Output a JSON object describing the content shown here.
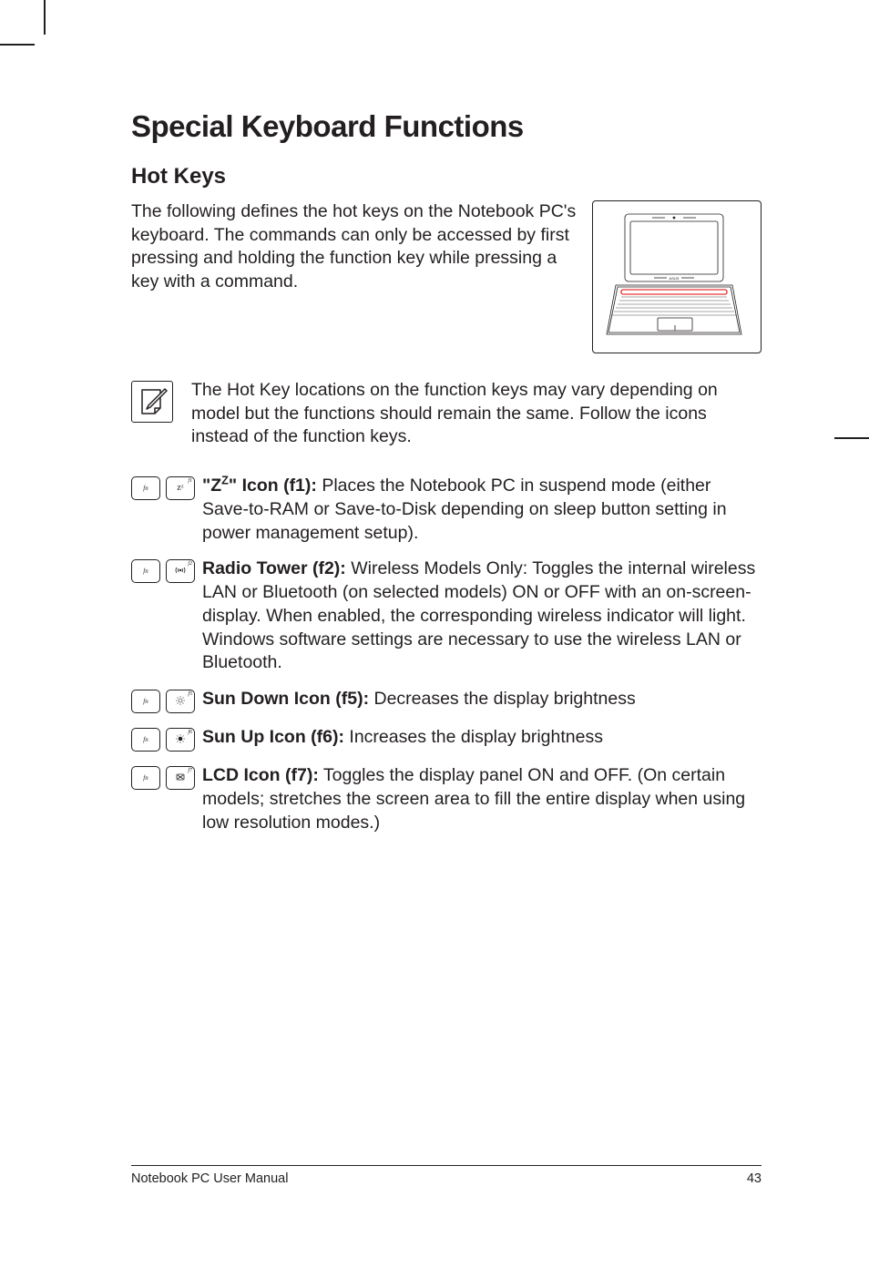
{
  "title": "Special Keyboard Functions",
  "subtitle": "Hot Keys",
  "intro": "The following defines the hot keys on the Notebook PC's keyboard. The commands can only be accessed by first pressing and holding the function key while pressing a key with a command.",
  "note": "The Hot Key locations on the function keys may vary depending on model but the functions should remain the same. Follow the icons instead of the function keys.",
  "keys": {
    "fn_label": "fn",
    "f1": {
      "f": "f1",
      "glyph": "zᶻ",
      "label": "\"Zᶻ\" Icon (f1):",
      "desc": " Places the Notebook PC in suspend mode (either Save-to-RAM or Save-to-Disk depending on sleep button setting in power management setup)."
    },
    "f2": {
      "f": "f2",
      "glyph": "(( ))",
      "label": "Radio Tower (f2):",
      "desc": " Wireless Models Only: Toggles the internal wireless LAN or Bluetooth (on selected models) ON or OFF with an on-screen-display. When enabled, the corresponding wireless indicator will light. Windows software settings are necessary to use the wireless LAN or Bluetooth."
    },
    "f5": {
      "f": "f5",
      "glyph": "☼",
      "label": "Sun Down Icon (f5):",
      "desc": " Decreases the display brightness"
    },
    "f6": {
      "f": "f6",
      "glyph": "☀",
      "label": "Sun Up Icon (f6):",
      "desc": " Increases the display brightness"
    },
    "f7": {
      "f": "f7",
      "glyph": "⊠",
      "label": "LCD Icon (f7):",
      "desc": " Toggles the display panel ON and OFF. (On certain models; stretches the screen area to fill the entire display when using low resolution modes.)"
    }
  },
  "footer_left": "Notebook PC User Manual",
  "footer_right": "43"
}
